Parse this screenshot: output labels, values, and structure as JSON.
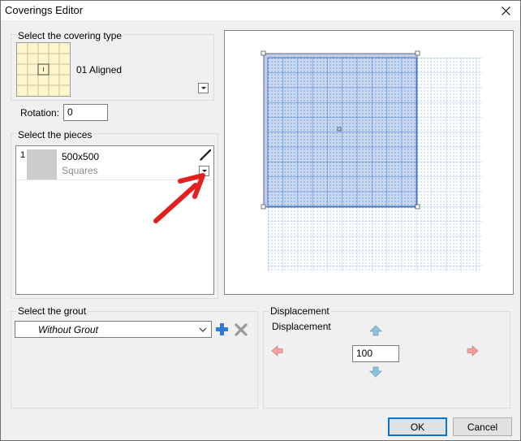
{
  "window": {
    "title": "Coverings Editor"
  },
  "covering_type": {
    "group_label": "Select the covering type",
    "selected_name": "01 Aligned"
  },
  "rotation": {
    "label": "Rotation:",
    "value": "0"
  },
  "pieces": {
    "group_label": "Select the pieces",
    "items": [
      {
        "index": "1",
        "name": "500x500",
        "subtitle": "Squares"
      }
    ]
  },
  "grout": {
    "group_label": "Select the grout",
    "selected": "Without Grout"
  },
  "displacement": {
    "group_label": "Displacement",
    "label": "Displacement",
    "value": "100"
  },
  "buttons": {
    "ok": "OK",
    "cancel": "Cancel"
  },
  "colors": {
    "accent": "#0078d7",
    "tile_fill": "#c9d8f0",
    "grid_line": "#3d7fdc",
    "arrow_red": "#e32020",
    "add_blue": "#2f7ad6",
    "delete_gray": "#9a9a9a"
  },
  "icons": {
    "close": "close-icon",
    "brush": "brush-icon",
    "arrow": "annotation-arrow",
    "add": "plus-icon",
    "delete": "x-icon",
    "up": "arrow-up-icon",
    "down": "arrow-down-icon",
    "left": "arrow-left-icon",
    "right": "arrow-right-icon"
  }
}
